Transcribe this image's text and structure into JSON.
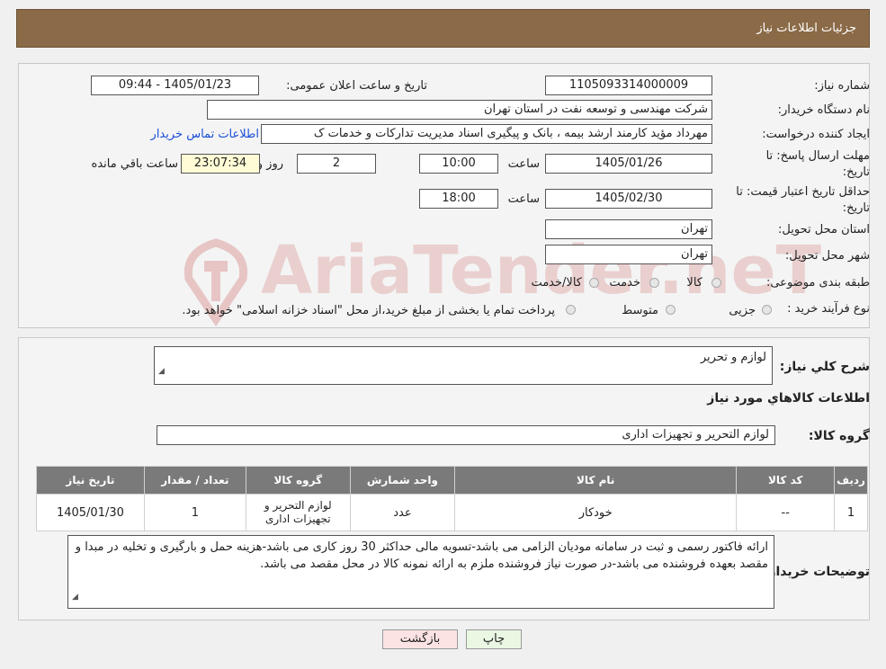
{
  "header": {
    "title": "جزئیات اطلاعات نیاز"
  },
  "watermark": {
    "text": "AriaTender.neT"
  },
  "fields": {
    "need_number_label": "شماره نیاز:",
    "need_number": "1105093314000009",
    "announce_label": "تاریخ و ساعت اعلان عمومی:",
    "announce_value": "1405/01/23 - 09:44",
    "buyer_label": "نام دستگاه خریدار:",
    "buyer_value": "شرکت مهندسی و توسعه نفت در استان تهران",
    "creator_label": "ایجاد کننده درخواست:",
    "creator_value": "مهرداد مؤید کارمند ارشد بیمه ، بانک و پیگیری اسناد مدیریت تدارکات و خدمات ک",
    "contact_link": "اطلاعات تماس خریدار",
    "deadline_label_1": "مهلت ارسال پاسخ: تا",
    "deadline_label_2": "تاریخ:",
    "deadline_date": "1405/01/26",
    "time_label": "ساعت",
    "deadline_time": "10:00",
    "days_value": "2",
    "days_label": "روز و",
    "remaining_value": "23:07:34",
    "remaining_label": "ساعت باقي مانده",
    "validity_label_1": "حداقل تاریخ اعتبار قیمت: تا",
    "validity_label_2": "تاریخ:",
    "validity_date": "1405/02/30",
    "validity_time": "18:00",
    "province_label": "استان محل تحویل:",
    "province_value": "تهران",
    "city_label": "شهر محل تحویل:",
    "city_value": "تهران",
    "category_label": "طبقه بندی موضوعی:",
    "category_options": [
      "کالا",
      "خدمت",
      "کالا/خدمت"
    ],
    "process_label": "نوع فرآیند خرید :",
    "process_options": [
      "جزیی",
      "متوسط"
    ],
    "process_note": "پرداخت تمام یا بخشی از مبلغ خرید،از محل \"اسناد خزانه اسلامی\" خواهد بود."
  },
  "summary": {
    "label": "شرح کلي نياز:",
    "value": "لوازم و تحریر",
    "goods_info_title": "اطلاعات کالاهاي مورد نياز",
    "group_label": "گروه کالا:",
    "group_value": "لوازم التحریر و تجهیزات اداری"
  },
  "table": {
    "headers": [
      "ردیف",
      "کد کالا",
      "نام کالا",
      "واحد شمارش",
      "گروه کالا",
      "تعداد / مقدار",
      "تاریخ نیاز"
    ],
    "rows": [
      [
        "1",
        "--",
        "خودکار",
        "عدد",
        "لوازم التحریر و تجهیزات اداری",
        "1",
        "1405/01/30"
      ]
    ]
  },
  "buyer_notes": {
    "label": "توضیحات خریدار:",
    "text": "ارائه فاکتور رسمی و ثبت در سامانه مودیان الزامی می باشد-تسویه مالی حداکثر 30 روز کاری می باشد-هزینه حمل و بارگیری و تخلیه در مبدا و مقصد بعهده فروشنده می باشد-در صورت نیاز فروشنده ملزم به ارائه نمونه کالا در محل مقصد می باشد."
  },
  "buttons": {
    "print": "چاپ",
    "back": "بازگشت"
  },
  "colors": {
    "header_bg": "#8b6a47",
    "table_header_bg": "#7a7a7a",
    "print_btn": "#eaf7e3",
    "back_btn": "#fbe3e3"
  }
}
